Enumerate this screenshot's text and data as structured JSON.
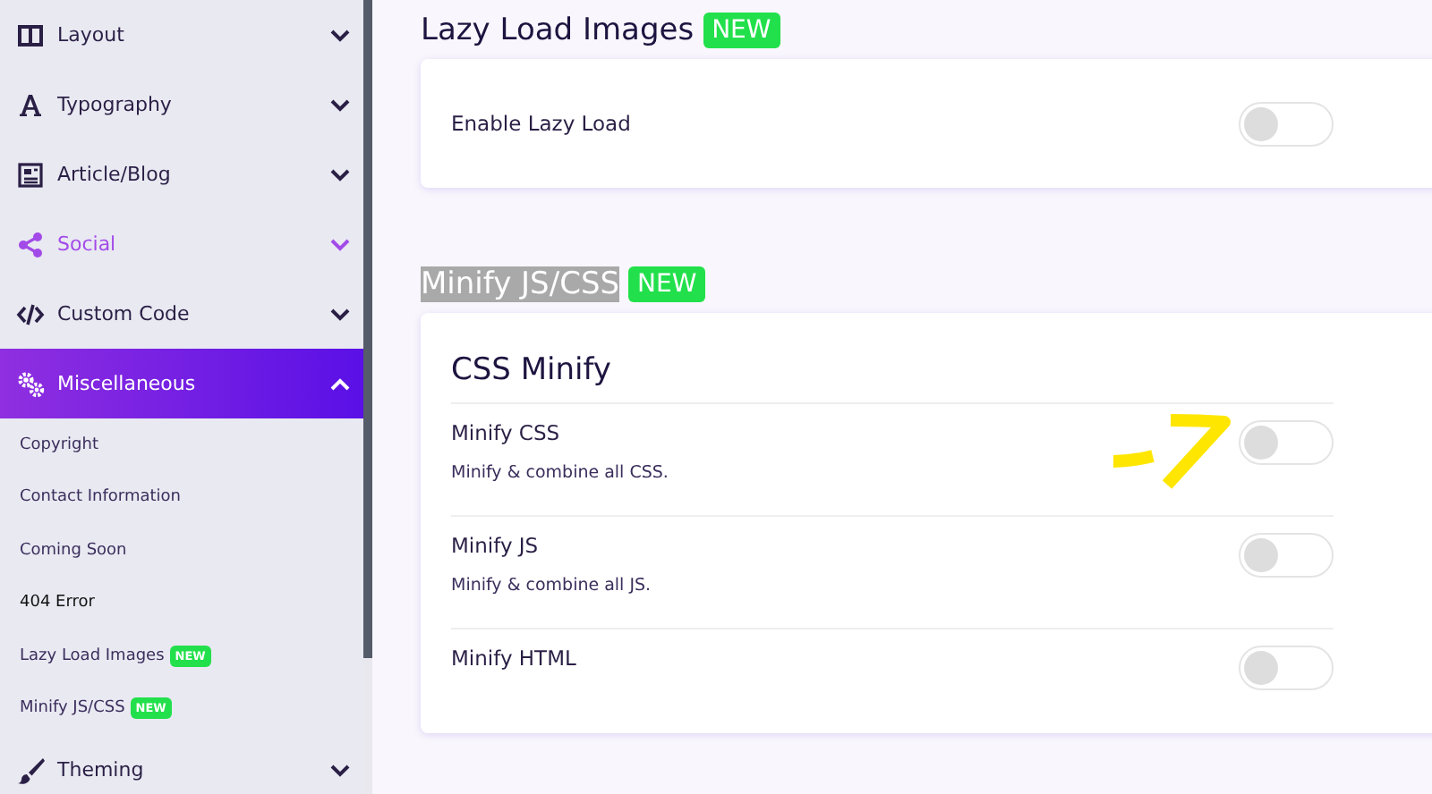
{
  "sidebar": {
    "items": [
      {
        "label": "Layout",
        "expanded": false,
        "highlighted": false
      },
      {
        "label": "Typography",
        "expanded": false,
        "highlighted": false
      },
      {
        "label": "Article/Blog",
        "expanded": false,
        "highlighted": false
      },
      {
        "label": "Social",
        "expanded": false,
        "highlighted": true
      },
      {
        "label": "Custom Code",
        "expanded": false,
        "highlighted": false
      },
      {
        "label": "Miscellaneous",
        "expanded": true,
        "highlighted": false,
        "children": [
          {
            "label": "Copyright",
            "selected": false
          },
          {
            "label": "Contact Information",
            "selected": false
          },
          {
            "label": "Coming Soon",
            "selected": false
          },
          {
            "label": "404 Error",
            "selected": true
          },
          {
            "label": "Lazy Load Images",
            "badge": "NEW",
            "selected": false
          },
          {
            "label": "Minify JS/CSS",
            "badge": "NEW",
            "selected": false
          }
        ]
      },
      {
        "label": "Theming",
        "expanded": false,
        "highlighted": false
      }
    ]
  },
  "sections": [
    {
      "title": "Lazy Load Images",
      "badge": "NEW",
      "text_selected": false,
      "card": {
        "rows": [
          {
            "label": "Enable Lazy Load",
            "on": false
          }
        ]
      }
    },
    {
      "title": "Minify JS/CSS",
      "badge": "NEW",
      "text_selected": true,
      "card": {
        "title": "CSS Minify",
        "rows": [
          {
            "label": "Minify CSS",
            "description": "Minify & combine all CSS.",
            "on": false,
            "annotated": true
          },
          {
            "label": "Minify JS",
            "description": "Minify & combine all JS.",
            "on": false
          },
          {
            "label": "Minify HTML",
            "on": false
          }
        ]
      }
    }
  ]
}
